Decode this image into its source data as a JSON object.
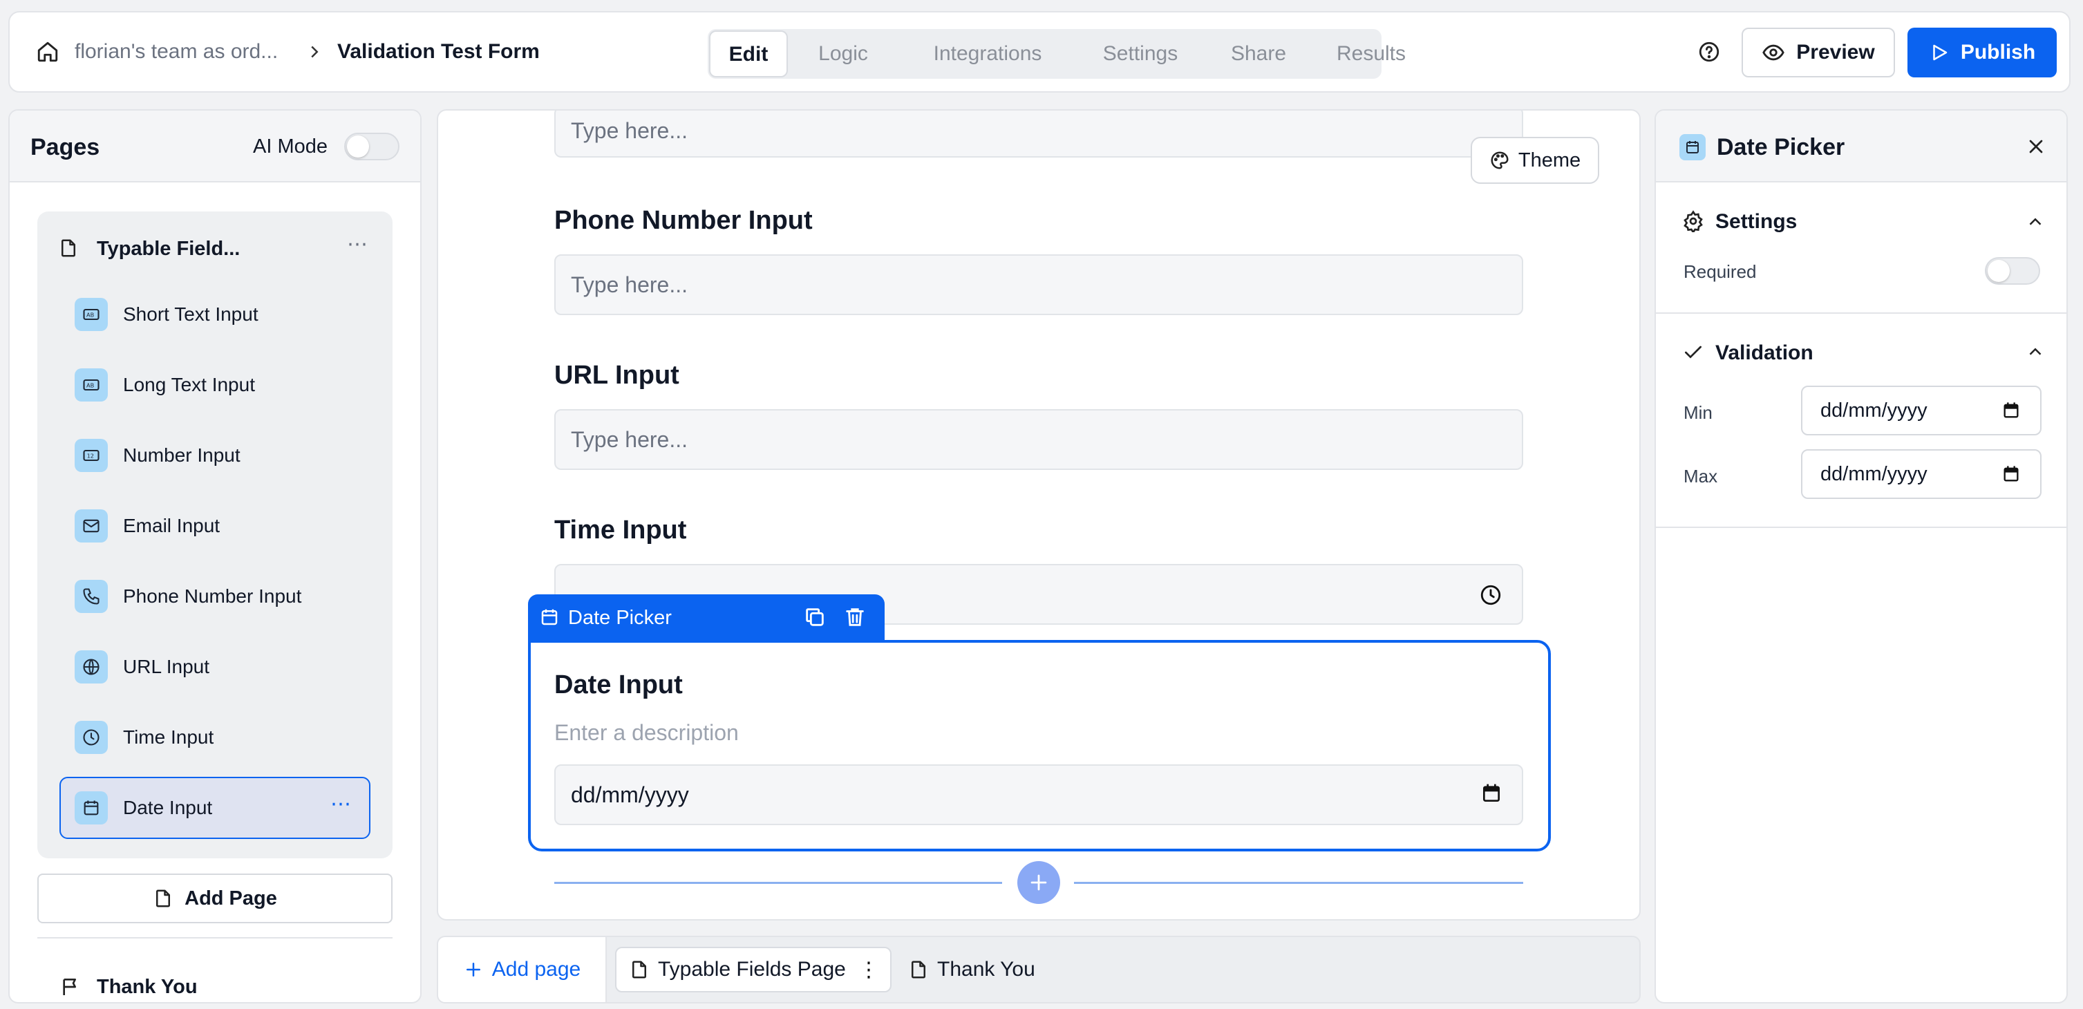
{
  "header": {
    "workspace": "florian's team as ord...",
    "form_title": "Validation Test Form",
    "tabs": [
      "Edit",
      "Logic",
      "Integrations",
      "Settings",
      "Share",
      "Results"
    ],
    "active_tab": "Edit",
    "preview_label": "Preview",
    "publish_label": "Publish"
  },
  "colors": {
    "primary": "#0b63f0",
    "icon_bg": "#a8d8f8",
    "selected_bg": "#dfe3f1"
  },
  "sidebar": {
    "title": "Pages",
    "ai_mode_label": "AI Mode",
    "page_name": "Typable Field...",
    "fields": [
      {
        "label": "Short Text Input",
        "icon": "text-ab-icon"
      },
      {
        "label": "Long Text Input",
        "icon": "text-ab-icon"
      },
      {
        "label": "Number Input",
        "icon": "number-icon"
      },
      {
        "label": "Email Input",
        "icon": "mail-icon"
      },
      {
        "label": "Phone Number Input",
        "icon": "phone-icon"
      },
      {
        "label": "URL Input",
        "icon": "globe-icon"
      },
      {
        "label": "Time Input",
        "icon": "clock-icon"
      },
      {
        "label": "Date Input",
        "icon": "calendar-icon"
      }
    ],
    "add_page_label": "Add Page",
    "thank_you_label": "Thank You"
  },
  "canvas": {
    "theme_label": "Theme",
    "placeholder": "Type here...",
    "questions": [
      {
        "label": "Phone Number Input"
      },
      {
        "label": "URL Input"
      },
      {
        "label": "Time Input"
      }
    ],
    "time_value_partial": "- -",
    "selected_block": {
      "type_label": "Date Picker",
      "label": "Date Input",
      "description_placeholder": "Enter a description",
      "date_placeholder": "dd/mm/yyyy"
    }
  },
  "bottom_bar": {
    "add_page_label": "Add page",
    "pages": [
      "Typable Fields Page",
      "Thank You"
    ]
  },
  "properties": {
    "title": "Date Picker",
    "settings_label": "Settings",
    "required_label": "Required",
    "validation_label": "Validation",
    "min_label": "Min",
    "max_label": "Max",
    "min_value": "dd/mm/yyyy",
    "max_value": "dd/mm/yyyy"
  }
}
